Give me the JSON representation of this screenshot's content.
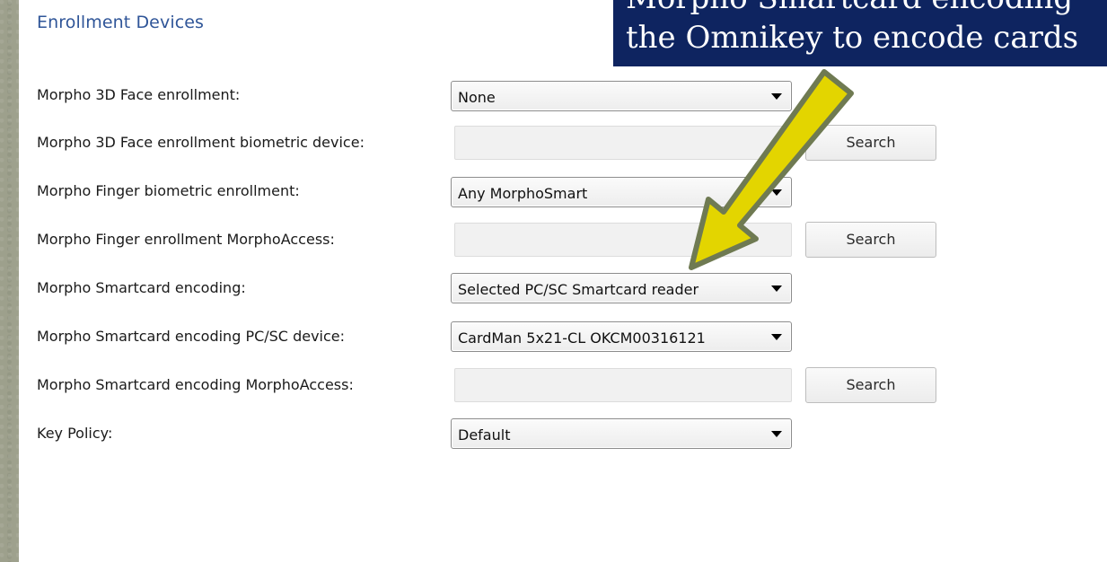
{
  "panel": {
    "title": "Enrollment Devices"
  },
  "rows": [
    {
      "label": "Morpho 3D Face enrollment:",
      "kind": "select",
      "value": "None"
    },
    {
      "label": "Morpho 3D Face enrollment biometric device:",
      "kind": "text",
      "value": "",
      "button": "Search"
    },
    {
      "label": "Morpho Finger biometric enrollment:",
      "kind": "select",
      "value": "Any MorphoSmart"
    },
    {
      "label": "Morpho Finger enrollment MorphoAccess:",
      "kind": "text",
      "value": "",
      "button": "Search"
    },
    {
      "label": "Morpho Smartcard encoding:",
      "kind": "select",
      "value": "Selected PC/SC Smartcard reader"
    },
    {
      "label": "Morpho Smartcard encoding PC/SC device:",
      "kind": "select",
      "value": "CardMan 5x21-CL OKCM00316121"
    },
    {
      "label": "Morpho Smartcard encoding MorphoAccess:",
      "kind": "text",
      "value": "",
      "button": "Search"
    },
    {
      "label": "Key Policy:",
      "kind": "select",
      "value": "Default"
    }
  ],
  "callout": {
    "line1": "Morpho Smartcard encoding",
    "line2": "the Omnikey to encode  cards",
    "background": "#0e2460",
    "arrow_color": "#e3d500",
    "arrow_outline": "#6f7a52"
  },
  "colors": {
    "title": "#2f5598",
    "panel_bg": "#ffffff",
    "frame_bg": "#a9ab97"
  }
}
